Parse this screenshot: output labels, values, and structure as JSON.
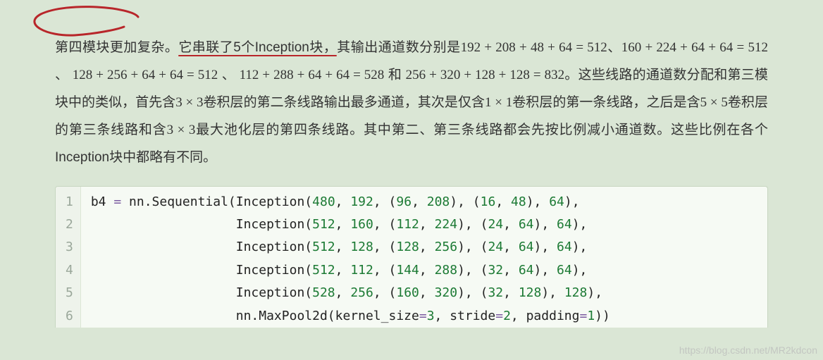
{
  "paragraph": {
    "s1a": "第四模块更加复杂。",
    "s1b": "它串联了5个Inception块，",
    "s1c": "其输出通道数分别是",
    "eq1": "192 + 208 + 48 + 64 = 512",
    "sep1": "、",
    "eq2": "160 + 224 + 64 + 64 = 512",
    "sep2": " 、 ",
    "eq3": "128 + 256 + 64 + 64 = 512",
    "sep3": " 、 ",
    "eq4": "112 + 288 + 64 + 64 = 528",
    "and": " 和 ",
    "eq5": "256 + 320 + 128 + 128 = 832",
    "s2": "。这些线路的通道数分配和第三模块中的类似，首先含",
    "m33a": "3 × 3",
    "s3": "卷积层的第二条线路输出最多通道，其次是仅含",
    "m11": "1 × 1",
    "s4": "卷积层的第一条线路，之后是含",
    "m55": "5 × 5",
    "s5": "卷积层的第三条线路和含",
    "m33b": "3 × 3",
    "s6": "最大池化层的第四条线路。其中第二、第三条线路都会先按比例减小通道数。这些比例在各个Inception块中都略有不同。"
  },
  "code": {
    "lines": [
      "1",
      "2",
      "3",
      "4",
      "5",
      "6"
    ],
    "l1": {
      "a": "b4 ",
      "b": "=",
      "c": " nn.Sequential(Inception(",
      "n": [
        "480",
        "192",
        "96",
        "208",
        "16",
        "48",
        "64"
      ],
      "e": "),"
    },
    "l2": {
      "a": "                   Inception(",
      "n": [
        "512",
        "160",
        "112",
        "224",
        "24",
        "64",
        "64"
      ],
      "e": "),"
    },
    "l3": {
      "a": "                   Inception(",
      "n": [
        "512",
        "128",
        "128",
        "256",
        "24",
        "64",
        "64"
      ],
      "e": "),"
    },
    "l4": {
      "a": "                   Inception(",
      "n": [
        "512",
        "112",
        "144",
        "288",
        "32",
        "64",
        "64"
      ],
      "e": "),"
    },
    "l5": {
      "a": "                   Inception(",
      "n": [
        "528",
        "256",
        "160",
        "320",
        "32",
        "128",
        "128"
      ],
      "e": "),"
    },
    "l6": {
      "a": "                   nn.MaxPool2d(kernel_size",
      "b": "=",
      "n1": "3",
      "c": ", stride",
      "n2": "2",
      "d": ", padding",
      "n3": "1",
      "e": "))"
    }
  },
  "watermark": "https://blog.csdn.net/MR2kdcon"
}
